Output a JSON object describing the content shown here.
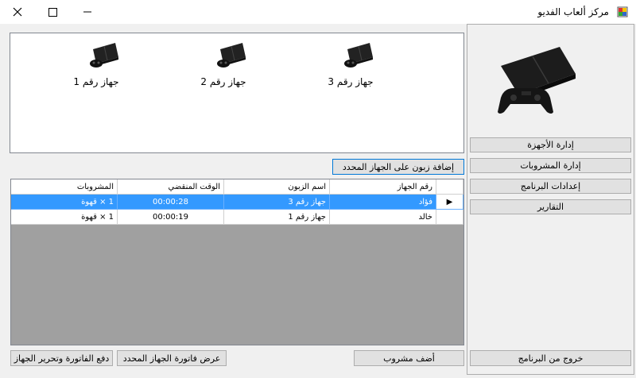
{
  "window": {
    "title": "مركز ألعاب الفديو"
  },
  "devices": [
    {
      "label": "جهاز رقم 3"
    },
    {
      "label": "جهاز رقم 2"
    },
    {
      "label": "جهاز رقم 1"
    }
  ],
  "buttons": {
    "add_customer": "إضافة زبون على الجهاز المحدد",
    "add_drink": "أضف مشروب",
    "view_invoice": "عرض فاتورة الجهاز المحدد",
    "pay_invoice": "دفع الفاتورة وتحرير الجهاز"
  },
  "sidebar": {
    "items": [
      {
        "label": "إدارة الأجهزة"
      },
      {
        "label": "إدارة المشروبات"
      },
      {
        "label": "إعدادات البرنامج"
      },
      {
        "label": "التقارير"
      }
    ],
    "exit_label": "خروج من البرنامج"
  },
  "table": {
    "columns": [
      "رقم الجهاز",
      "اسم الزبون",
      "الوقت المنقضي",
      "المشروبات"
    ],
    "rows": [
      {
        "customer": "فؤاد",
        "device": "جهاز رقم 3",
        "elapsed": "00:00:28",
        "drinks": "1 × قهوة"
      },
      {
        "customer": "خالد",
        "device": "جهاز رقم 1",
        "elapsed": "00:00:19",
        "drinks": "1 × قهوة"
      }
    ],
    "current_row_marker": "▶"
  },
  "colors": {
    "selection": "#3399ff",
    "grid_background": "#a0a0a0",
    "button_face": "#e1e1e1"
  }
}
